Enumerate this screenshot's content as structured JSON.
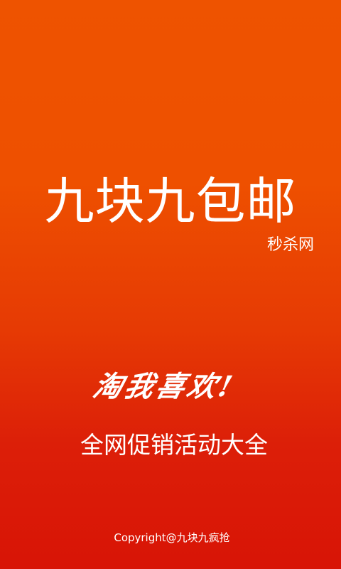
{
  "splash": {
    "title": "九块九包邮",
    "subtitle": "秒杀网",
    "slogan": "淘我喜欢!",
    "tagline": "全网促销活动大全",
    "copyright": "Copyright@九块九疯抢"
  },
  "colors": {
    "background_top": "#ee5300",
    "background_bottom": "#d81406",
    "text": "#ffffff"
  }
}
